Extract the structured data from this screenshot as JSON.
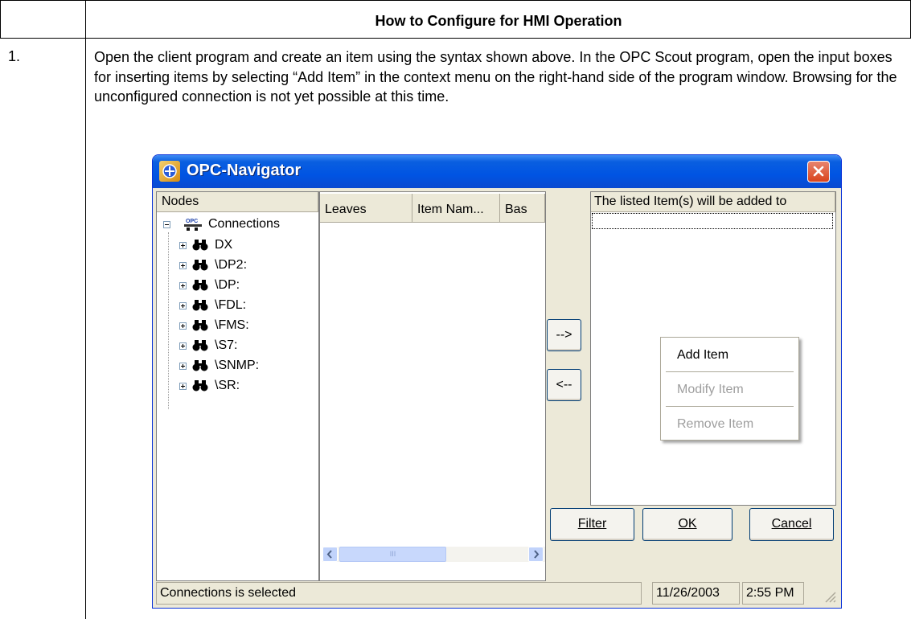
{
  "document": {
    "header": "How to Configure for HMI Operation",
    "step_number": "1.",
    "step_text": "Open the client program and create an item using the syntax shown above. In the OPC Scout program, open the input boxes for inserting items by selecting “Add Item” in the context menu on the right-hand side of the program window. Browsing for the unconfigured connection is not yet possible at this time."
  },
  "dialog": {
    "title": "OPC-Navigator",
    "nodes_header": "Nodes",
    "tree": {
      "root": "Connections",
      "children": [
        "DX",
        "\\DP2:",
        "\\DP:",
        "\\FDL:",
        "\\FMS:",
        "\\S7:",
        "\\SNMP:",
        "\\SR:"
      ]
    },
    "leaves_columns": [
      "Leaves",
      "Item Nam...",
      "Bas"
    ],
    "right_header": "The listed Item(s) will be added to",
    "add_arrow": "-->",
    "remove_arrow": "<--",
    "context_menu": {
      "add": "Add Item",
      "modify": "Modify Item",
      "remove": "Remove Item"
    },
    "buttons": {
      "filter": "Filter",
      "ok": "OK",
      "cancel": "Cancel"
    },
    "scroll_thumb_label": "III",
    "status": {
      "message": "Connections is selected",
      "date": "11/26/2003",
      "time": "2:55 PM"
    },
    "icons": {
      "title": "opc-navigator-icon",
      "root": "opc-connections-icon",
      "child": "binoculars-icon",
      "close": "close-icon"
    }
  }
}
